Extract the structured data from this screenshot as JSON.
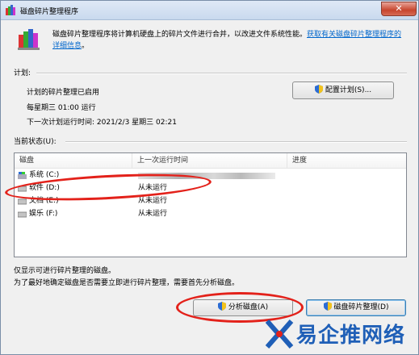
{
  "window": {
    "title": "磁盘碎片整理程序",
    "close_symbol": "✕"
  },
  "intro": {
    "text": "磁盘碎片整理程序将计算机硬盘上的碎片文件进行合并，以改进文件系统性能。",
    "link": "获取有关磁盘碎片整理程序的详细信息",
    "end": "。"
  },
  "schedule": {
    "group_label": "计划:",
    "status": "计划的碎片整理已启用",
    "frequency": "每星期三 01:00 运行",
    "next_run": "下一次计划运行时间: 2021/2/3 星期三 02:21",
    "configure_button": "配置计划(S)..."
  },
  "current_status": {
    "group_label": "当前状态(U):",
    "columns": [
      "磁盘",
      "上一次运行时间",
      "进度"
    ],
    "disks": [
      {
        "name": "系统 (C:)",
        "last_run": ""
      },
      {
        "name": "软件 (D:)",
        "last_run": "从未运行"
      },
      {
        "name": "文档 (E:)",
        "last_run": "从未运行"
      },
      {
        "name": "娱乐 (F:)",
        "last_run": "从未运行"
      }
    ]
  },
  "notes": {
    "line1": "仅显示可进行碎片整理的磁盘。",
    "line2": "为了最好地确定磁盘是否需要立即进行碎片整理，需要首先分析磁盘。"
  },
  "actions": {
    "analyze_button": "分析磁盘(A)",
    "defrag_button": "磁盘碎片整理(D)"
  },
  "watermark": {
    "text": "易企推网络"
  },
  "colors": {
    "accent": "#0066cc",
    "annotation": "#e3211a",
    "watermark": "#1f5fb7"
  },
  "icons": [
    "defrag-app-icon",
    "shield-icon",
    "drive-icon",
    "close-icon"
  ]
}
